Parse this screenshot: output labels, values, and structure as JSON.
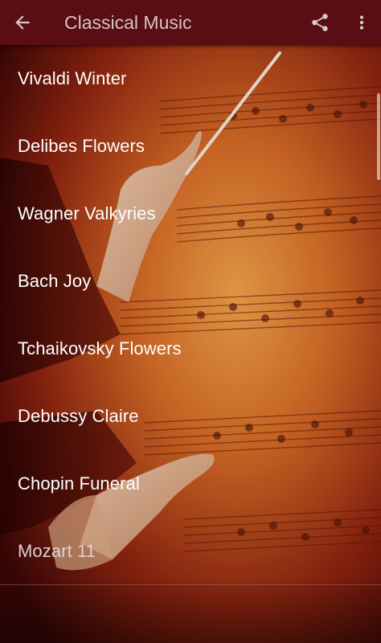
{
  "app_bar": {
    "title": "Classical Music",
    "back_icon": "arrow-back-icon",
    "share_icon": "share-icon",
    "overflow_icon": "more-vert-icon",
    "background_color": "#5a0d12"
  },
  "songs": [
    {
      "label": "Vivaldi Winter"
    },
    {
      "label": "Delibes Flowers"
    },
    {
      "label": "Wagner Valkyries"
    },
    {
      "label": "Bach Joy"
    },
    {
      "label": "Tchaikovsky Flowers"
    },
    {
      "label": "Debussy Claire"
    },
    {
      "label": "Chopin Funeral"
    },
    {
      "label": "Mozart 11"
    }
  ],
  "background": {
    "description_icon": "conductor-sheet-music-image",
    "accent_color": "#e08a3a",
    "dark_color": "#3a0606"
  }
}
